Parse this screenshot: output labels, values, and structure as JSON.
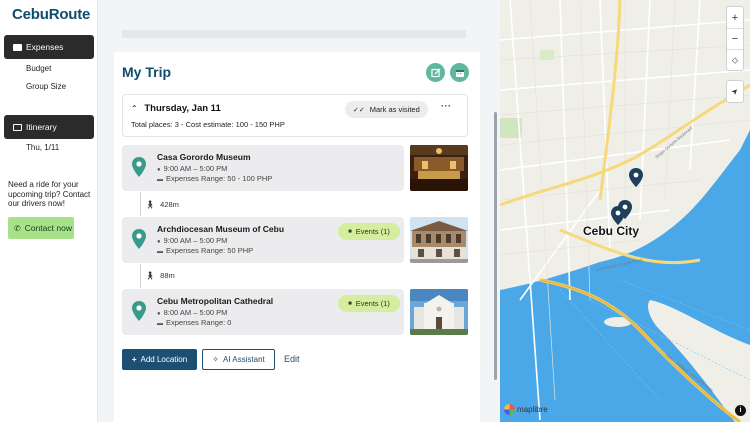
{
  "app": {
    "logo": "CebuRoute"
  },
  "sidebar": {
    "expenses_label": "Expenses",
    "expenses_items": [
      "Budget",
      "Group Size"
    ],
    "itinerary_label": "Itinerary",
    "itinerary_items": [
      "Thu, 1/11"
    ],
    "ride_text": "Need a ride for your upcoming trip? Contact our drivers now!",
    "contact_label": "Contact now"
  },
  "trip": {
    "title": "My Trip",
    "day": {
      "title": "Thursday, Jan 11",
      "meta": "Total places: 3 - Cost estimate: 100 - 150 PHP",
      "mark_visited_label": "Mark as visited",
      "more_label": "···"
    },
    "places": [
      {
        "name": "Casa Gorordo Museum",
        "hours": "9:00 AM – 5:00 PM",
        "expenses": "Expenses Range: 50 - 100 PHP",
        "events": ""
      },
      {
        "name": "Archdiocesan Museum of Cebu",
        "hours": "9:00 AM – 5:00 PM",
        "expenses": "Expenses Range: 50 PHP",
        "events": "Events (1)"
      },
      {
        "name": "Cebu Metropolitan Cathedral",
        "hours": "8:00 AM – 5:00 PM",
        "expenses": "Expenses Range: 0",
        "events": "Events (1)"
      }
    ],
    "walks": [
      "428m",
      "88m"
    ],
    "add_location_label": "Add Location",
    "ai_assistant_label": "AI Assistant",
    "edit_label": "Edit"
  },
  "map": {
    "city_label": "Cebu City",
    "attribution": "maplibre",
    "zoom_in": "+",
    "zoom_out": "−",
    "compass": "⬦",
    "locate": "➤",
    "info": "i",
    "road_labels": [
      "Cebu South Coastal Road",
      "Cebu - Cordova Link Expressway",
      "Sergio Osmeña Boulevard"
    ]
  },
  "colors": {
    "primary": "#0f4c6e",
    "accent_green": "#5fb79d",
    "events_bg": "#d4ed9e",
    "contact_bg": "#a7e28a",
    "sea": "#4aa8e8"
  }
}
